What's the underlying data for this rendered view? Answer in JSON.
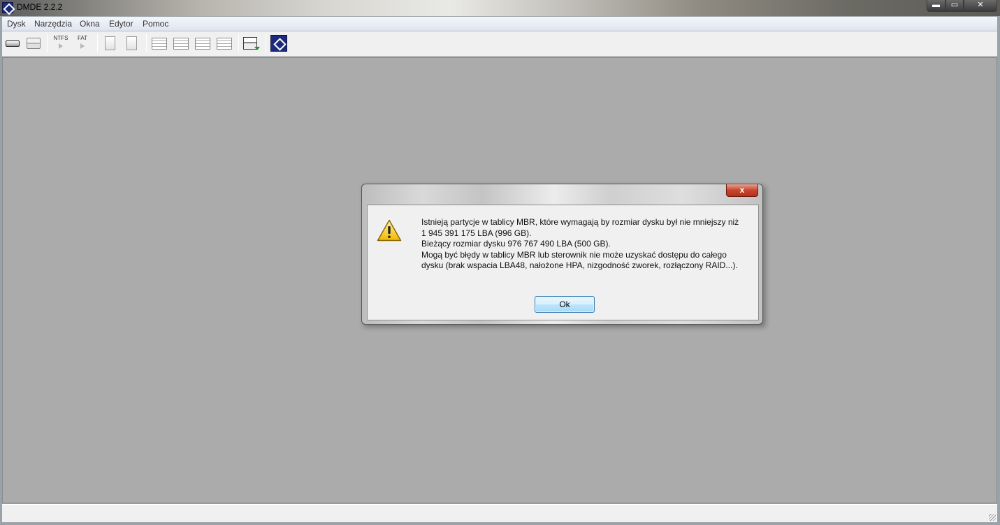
{
  "window": {
    "title": "DMDE 2.2.2",
    "minimize": "▬",
    "maximize": "▭",
    "close": "✕"
  },
  "menu": [
    "Dysk",
    "Narzędzia",
    "Okna",
    "Edytor",
    "Pomoc"
  ],
  "toolbar": {
    "ntfs_label": "NTFS",
    "fat_label": "FAT",
    "icons": [
      "drive-icon",
      "partitions-icon",
      "ntfs-icon",
      "fat-icon",
      "open-file-icon",
      "new-file-icon",
      "list-view-icon",
      "detail-view-icon",
      "grid-view-icon",
      "search-icon",
      "disk-copy-icon",
      "dmde-logo-icon"
    ]
  },
  "dialog": {
    "close": "x",
    "icon": "warning-icon",
    "lines": [
      "Istnieją partycje w tablicy MBR, które wymagają by rozmiar dysku był nie mniejszy niż",
      "1 945 391 175 LBA (996 GB).",
      "Bieżący rozmiar dysku 976 767 490 LBA (500 GB).",
      "Mogą być błędy w tablicy MBR lub sterownik nie może uzyskać dostępu do całego",
      "dysku (brak wspacia LBA48, nałożone HPA, nizgodność zworek, rozłączony RAID...)."
    ],
    "ok_label": "Ok"
  },
  "colors": {
    "workspace": "#ababab",
    "ok_border": "#3c7fb1",
    "close_red": "#c9452d",
    "logo_blue": "#1d2a7a"
  }
}
